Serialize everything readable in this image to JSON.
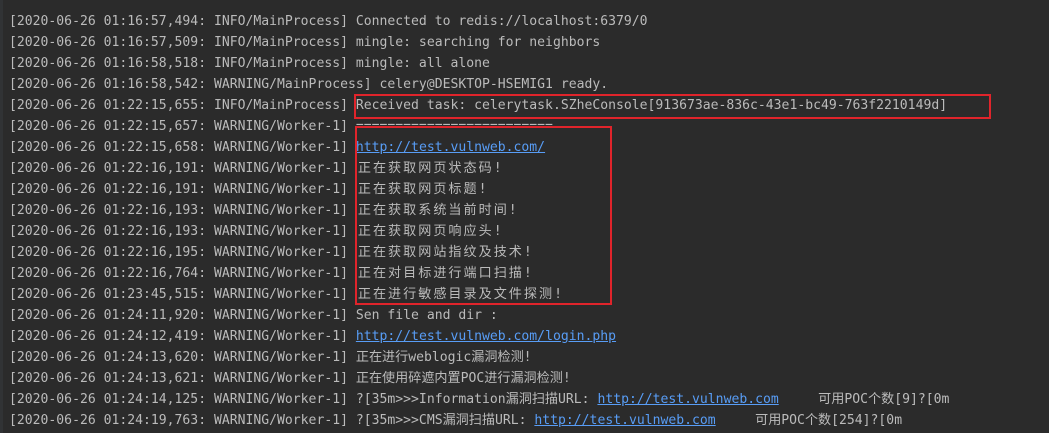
{
  "console": {
    "lines": [
      {
        "prefix": "[2020-06-26 01:16:57,494: INFO/MainProcess]",
        "text": " Connected to redis://localhost:6379/0"
      },
      {
        "prefix": "[2020-06-26 01:16:57,509: INFO/MainProcess]",
        "text": " mingle: searching for neighbors"
      },
      {
        "prefix": "[2020-06-26 01:16:58,518: INFO/MainProcess]",
        "text": " mingle: all alone"
      },
      {
        "prefix": "[2020-06-26 01:16:58,542: WARNING/MainProcess]",
        "text": " celery@DESKTOP-HSEMIG1 ready."
      },
      {
        "prefix": "[2020-06-26 01:22:15,655: INFO/MainProcess]",
        "text": " Received task: celerytask.SZheConsole[913673ae-836c-43e1-bc49-763f2210149d]"
      },
      {
        "prefix": "[2020-06-26 01:22:15,657: WARNING/Worker-1]",
        "text": " ========================="
      },
      {
        "prefix": "[2020-06-26 01:22:15,658: WARNING/Worker-1]",
        "text": " ",
        "link": "http://test.vulnweb.com/"
      },
      {
        "prefix": "[2020-06-26 01:22:16,191: WARNING/Worker-1]",
        "text": " 正在获取网页状态码!",
        "cjk": true
      },
      {
        "prefix": "[2020-06-26 01:22:16,191: WARNING/Worker-1]",
        "text": " 正在获取网页标题!",
        "cjk": true
      },
      {
        "prefix": "[2020-06-26 01:22:16,193: WARNING/Worker-1]",
        "text": " 正在获取系统当前时间!",
        "cjk": true
      },
      {
        "prefix": "[2020-06-26 01:22:16,193: WARNING/Worker-1]",
        "text": " 正在获取网页响应头!",
        "cjk": true
      },
      {
        "prefix": "[2020-06-26 01:22:16,195: WARNING/Worker-1]",
        "text": " 正在获取网站指纹及技术!",
        "cjk": true
      },
      {
        "prefix": "[2020-06-26 01:22:16,764: WARNING/Worker-1]",
        "text": " 正在对目标进行端口扫描!",
        "cjk": true
      },
      {
        "prefix": "[2020-06-26 01:23:45,515: WARNING/Worker-1]",
        "text": " 正在进行敏感目录及文件探测!",
        "cjk": true
      },
      {
        "prefix": "[2020-06-26 01:24:11,920: WARNING/Worker-1]",
        "text": " Sen file and dir :"
      },
      {
        "prefix": "[2020-06-26 01:24:12,419: WARNING/Worker-1]",
        "text": " ",
        "link": "http://test.vulnweb.com/login.php"
      },
      {
        "prefix": "[2020-06-26 01:24:13,620: WARNING/Worker-1]",
        "text": " 正在进行weblogic漏洞检测!"
      },
      {
        "prefix": "[2020-06-26 01:24:13,621: WARNING/Worker-1]",
        "text": " 正在使用碎遮内置POC进行漏洞检测!"
      },
      {
        "prefix": "[2020-06-26 01:24:14,125: WARNING/Worker-1]",
        "text": " ?[35m>>>Information漏洞扫描URL: ",
        "link": "http://test.vulnweb.com",
        "suffix": "     可用POC个数[9]?[0m"
      },
      {
        "prefix": "[2020-06-26 01:24:19,763: WARNING/Worker-1]",
        "text": " ?[35m>>>CMS漏洞扫描URL: ",
        "link": "http://test.vulnweb.com",
        "suffix": "     可用POC个数[254]?[0m"
      }
    ]
  },
  "colors": {
    "background": "#2b2b2b",
    "text": "#bbbbbb",
    "link": "#589df6",
    "highlight": "#e0242b"
  }
}
